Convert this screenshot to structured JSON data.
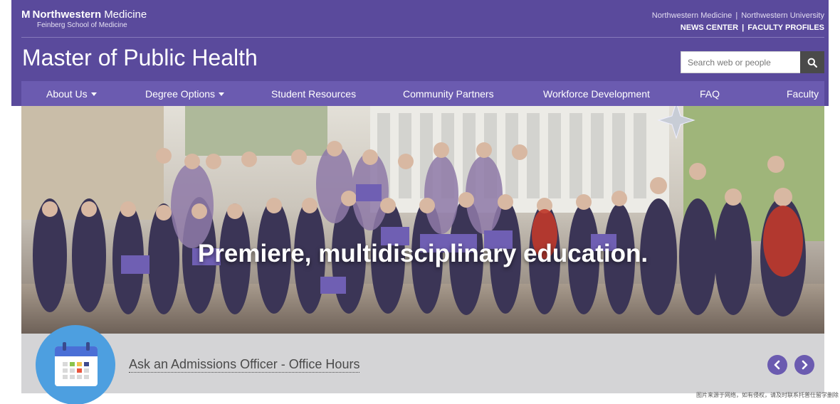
{
  "header": {
    "logo_mark": "M",
    "logo_bold": "Northwestern",
    "logo_light": "Medicine",
    "logo_sub": "Feinberg School of Medicine",
    "top_link_1": "Northwestern Medicine",
    "top_link_2": "Northwestern University",
    "top_link_3": "NEWS CENTER",
    "top_link_4": "FACULTY PROFILES",
    "separator": "|",
    "site_title": "Master of Public Health"
  },
  "search": {
    "placeholder": "Search web or people",
    "icon": "search-icon"
  },
  "nav": {
    "items": [
      {
        "label": "About Us",
        "dropdown": true
      },
      {
        "label": "Degree Options",
        "dropdown": true
      },
      {
        "label": "Student Resources",
        "dropdown": false
      },
      {
        "label": "Community Partners",
        "dropdown": false
      },
      {
        "label": "Workforce Development",
        "dropdown": false
      },
      {
        "label": "FAQ",
        "dropdown": false
      },
      {
        "label": "Faculty",
        "dropdown": false
      }
    ]
  },
  "hero": {
    "heading": "Premiere, multidisciplinary education."
  },
  "announcement": {
    "link_text": "Ask an Admissions Officer - Office Hours",
    "icon": "calendar-icon",
    "prev_icon": "chevron-left-icon",
    "next_icon": "chevron-right-icon"
  },
  "watermark": "图片来源于网络，如有侵权，请及时联系托普仕留学删除",
  "colors": {
    "brand_purple": "#5a4a9c",
    "nav_purple": "#6b5bb0",
    "calendar_blue": "#4d9fe0"
  }
}
